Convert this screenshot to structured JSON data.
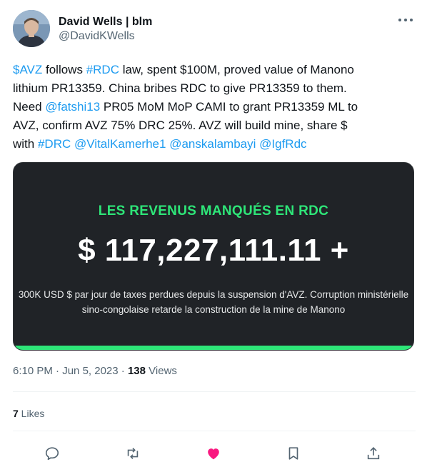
{
  "author": {
    "display_name": "David Wells | blm",
    "handle": "@DavidKWells"
  },
  "tweet": {
    "lines": [
      [
        {
          "text": "$AVZ",
          "link": true
        },
        {
          "text": " follows ",
          "link": false
        },
        {
          "text": "#RDC",
          "link": true
        },
        {
          "text": " law, spent $100M, proved value of Manono",
          "link": false
        }
      ],
      [
        {
          "text": "lithium PR13359. China bribes RDC to give PR13359 to them.",
          "link": false
        }
      ],
      [
        {
          "text": "Need ",
          "link": false
        },
        {
          "text": "@fatshi13",
          "link": true
        },
        {
          "text": " PR05 MoM MoP CAMI to grant PR13359 ML to",
          "link": false
        }
      ],
      [
        {
          "text": "AVZ, confirm AVZ 75% DRC 25%. AVZ will build mine, share $",
          "link": false
        }
      ],
      [
        {
          "text": "with ",
          "link": false
        },
        {
          "text": "#DRC",
          "link": true
        },
        {
          "text": " ",
          "link": false
        },
        {
          "text": "@VitalKamerhe1",
          "link": true
        },
        {
          "text": " ",
          "link": false
        },
        {
          "text": "@anskalambayi",
          "link": true
        },
        {
          "text": " ",
          "link": false
        },
        {
          "text": "@IgfRdc",
          "link": true
        }
      ]
    ]
  },
  "card": {
    "title": "LES REVENUS MANQUÉS EN RDC",
    "amount": "$ 117,227,111.11 +",
    "body_line1": "300K USD $ par jour de taxes perdues depuis la suspension d'AVZ. Corruption ministérielle",
    "body_line2": "sino-congolaise retarde la construction de la mine de Manono"
  },
  "meta": {
    "time": "6:10 PM",
    "separator": " · ",
    "date": "Jun 5, 2023",
    "views_count": "138",
    "views_label": " Views"
  },
  "likes": {
    "count": "7",
    "label": " Likes"
  },
  "colors": {
    "link": "#1d9bf0",
    "card_accent": "#2ee578",
    "like_pink": "#f91880",
    "muted": "#536471"
  },
  "icons": [
    "more-icon",
    "reply-icon",
    "retweet-icon",
    "like-icon",
    "bookmark-icon",
    "share-icon"
  ]
}
